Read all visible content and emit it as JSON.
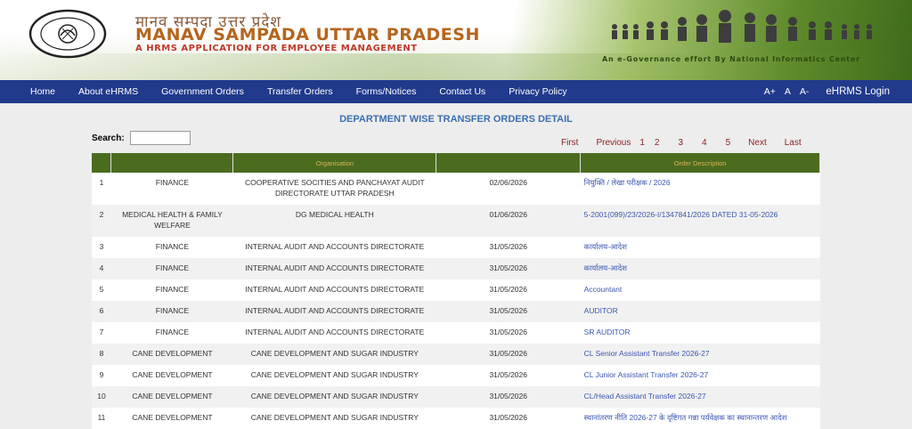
{
  "header": {
    "title_hindi": "मानव सम्पदा उत्तर प्रदेश",
    "title_english": "MANAV SAMPADA UTTAR PRADESH",
    "subtitle": "A HRMS APPLICATION FOR EMPLOYEE MANAGEMENT",
    "tagline": "An e-Governance effort By National Informatics Center",
    "emblem_text": "GOVERNMENT OF UTTAR PRADESH"
  },
  "nav": {
    "items": [
      "Home",
      "About eHRMS",
      "Government Orders",
      "Transfer Orders",
      "Forms/Notices",
      "Contact Us",
      "Privacy Policy"
    ],
    "font_increase": "A+",
    "font_normal": "A",
    "font_decrease": "A-",
    "login": "eHRMS Login"
  },
  "page": {
    "title": "DEPARTMENT WISE TRANSFER ORDERS DETAIL",
    "search_label": "Search:",
    "search_value": ""
  },
  "pager": {
    "first": "First",
    "previous": "Previous",
    "pages": [
      "1",
      "2",
      "3",
      "4",
      "5"
    ],
    "next": "Next",
    "last": "Last"
  },
  "table": {
    "headers": [
      "",
      "",
      "Organisation",
      "",
      "Order Description"
    ],
    "rows": [
      {
        "sn": "1",
        "dept": "FINANCE",
        "org": "COOPERATIVE SOCITIES AND PANCHAYAT AUDIT DIRECTORATE UTTAR PRADESH",
        "date": "02/06/2026",
        "desc": "नियुक्ति / लेखा परीक्षक / 2026"
      },
      {
        "sn": "2",
        "dept": "MEDICAL HEALTH & FAMILY WELFARE",
        "org": "DG MEDICAL HEALTH",
        "date": "01/06/2026",
        "desc": "5-2001(099)/23/2026-I/1347841/2026 DATED 31-05-2026"
      },
      {
        "sn": "3",
        "dept": "FINANCE",
        "org": "INTERNAL AUDIT AND ACCOUNTS DIRECTORATE",
        "date": "31/05/2026",
        "desc": "कार्यालय-आदेश"
      },
      {
        "sn": "4",
        "dept": "FINANCE",
        "org": "INTERNAL AUDIT AND ACCOUNTS DIRECTORATE",
        "date": "31/05/2026",
        "desc": "कार्यालय-आदेश"
      },
      {
        "sn": "5",
        "dept": "FINANCE",
        "org": "INTERNAL AUDIT AND ACCOUNTS DIRECTORATE",
        "date": "31/05/2026",
        "desc": "Accountant"
      },
      {
        "sn": "6",
        "dept": "FINANCE",
        "org": "INTERNAL AUDIT AND ACCOUNTS DIRECTORATE",
        "date": "31/05/2026",
        "desc": "AUDITOR"
      },
      {
        "sn": "7",
        "dept": "FINANCE",
        "org": "INTERNAL AUDIT AND ACCOUNTS DIRECTORATE",
        "date": "31/05/2026",
        "desc": "SR AUDITOR"
      },
      {
        "sn": "8",
        "dept": "CANE DEVELOPMENT",
        "org": "CANE DEVELOPMENT AND SUGAR INDUSTRY",
        "date": "31/05/2026",
        "desc": "CL Senior Assistant Transfer 2026-27"
      },
      {
        "sn": "9",
        "dept": "CANE DEVELOPMENT",
        "org": "CANE DEVELOPMENT AND SUGAR INDUSTRY",
        "date": "31/05/2026",
        "desc": "CL Junior Assistant Transfer 2026-27"
      },
      {
        "sn": "10",
        "dept": "CANE DEVELOPMENT",
        "org": "CANE DEVELOPMENT AND SUGAR INDUSTRY",
        "date": "31/05/2026",
        "desc": "CL/Head Assistant Transfer 2026-27"
      },
      {
        "sn": "11",
        "dept": "CANE DEVELOPMENT",
        "org": "CANE DEVELOPMENT AND SUGAR INDUSTRY",
        "date": "31/05/2026",
        "desc": "स्थानांतरण नीति 2026-27 के दृष्टिगत गन्ना पर्यवेक्षक का स्थानान्तरण आदेश"
      }
    ]
  },
  "colors": {
    "nav_bg": "#213a8c",
    "table_header_bg": "#4b6c1f",
    "link": "#3b57b0",
    "pager": "#8b1f1f",
    "title": "#3b6fb0"
  }
}
